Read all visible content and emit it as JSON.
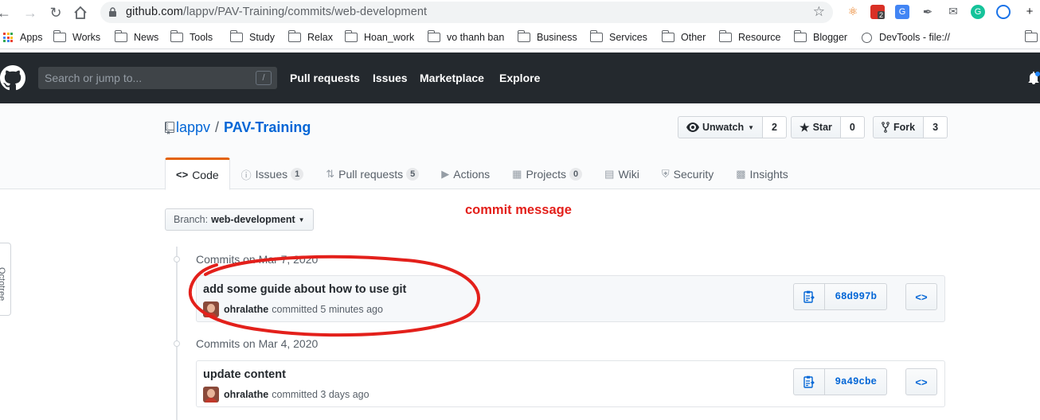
{
  "browser": {
    "url_host": "github.com",
    "url_path": "/lappv/PAV-Training/commits/web-development",
    "bookmarks": [
      "Apps",
      "Works",
      "News",
      "Tools",
      "Study",
      "Relax",
      "Hoan_work",
      "vo thanh ban",
      "Business",
      "Services",
      "Other",
      "Resource",
      "Blogger",
      "DevTools - file://"
    ],
    "ext_badge": "2"
  },
  "header": {
    "search_placeholder": "Search or jump to...",
    "search_shortcut": "/",
    "nav": [
      "Pull requests",
      "Issues",
      "Marketplace",
      "Explore"
    ]
  },
  "repo": {
    "owner": "lappv",
    "separator": "/",
    "name": "PAV-Training",
    "watch_label": "Unwatch",
    "watch_count": "2",
    "star_label": "Star",
    "star_count": "0",
    "fork_label": "Fork",
    "fork_count": "3"
  },
  "tabs": [
    {
      "label": "Code",
      "icon": "code-icon",
      "counter": ""
    },
    {
      "label": "Issues",
      "icon": "issue-icon",
      "counter": "1"
    },
    {
      "label": "Pull requests",
      "icon": "pull-request-icon",
      "counter": "5"
    },
    {
      "label": "Actions",
      "icon": "play-icon",
      "counter": ""
    },
    {
      "label": "Projects",
      "icon": "project-icon",
      "counter": "0"
    },
    {
      "label": "Wiki",
      "icon": "book-icon",
      "counter": ""
    },
    {
      "label": "Security",
      "icon": "shield-icon",
      "counter": ""
    },
    {
      "label": "Insights",
      "icon": "graph-icon",
      "counter": ""
    }
  ],
  "branch": {
    "prefix": "Branch:",
    "name": "web-development"
  },
  "annotation": "commit message",
  "commit_groups": [
    {
      "title": "Commits on Mar 7, 2020",
      "commit": {
        "message": "add some guide about how to use git",
        "author": "ohralathe",
        "action": "committed",
        "time": "5 minutes ago",
        "sha": "68d997b"
      }
    },
    {
      "title": "Commits on Mar 4, 2020",
      "commit": {
        "message": "update content",
        "author": "ohralathe",
        "action": "committed",
        "time": "3 days ago",
        "sha": "9a49cbe"
      }
    }
  ],
  "side_tab": "Octotree",
  "colors": {
    "accent": "#0366d6",
    "header_bg": "#24292e",
    "tab_active": "#e36209",
    "annotation": "#e3201b"
  }
}
